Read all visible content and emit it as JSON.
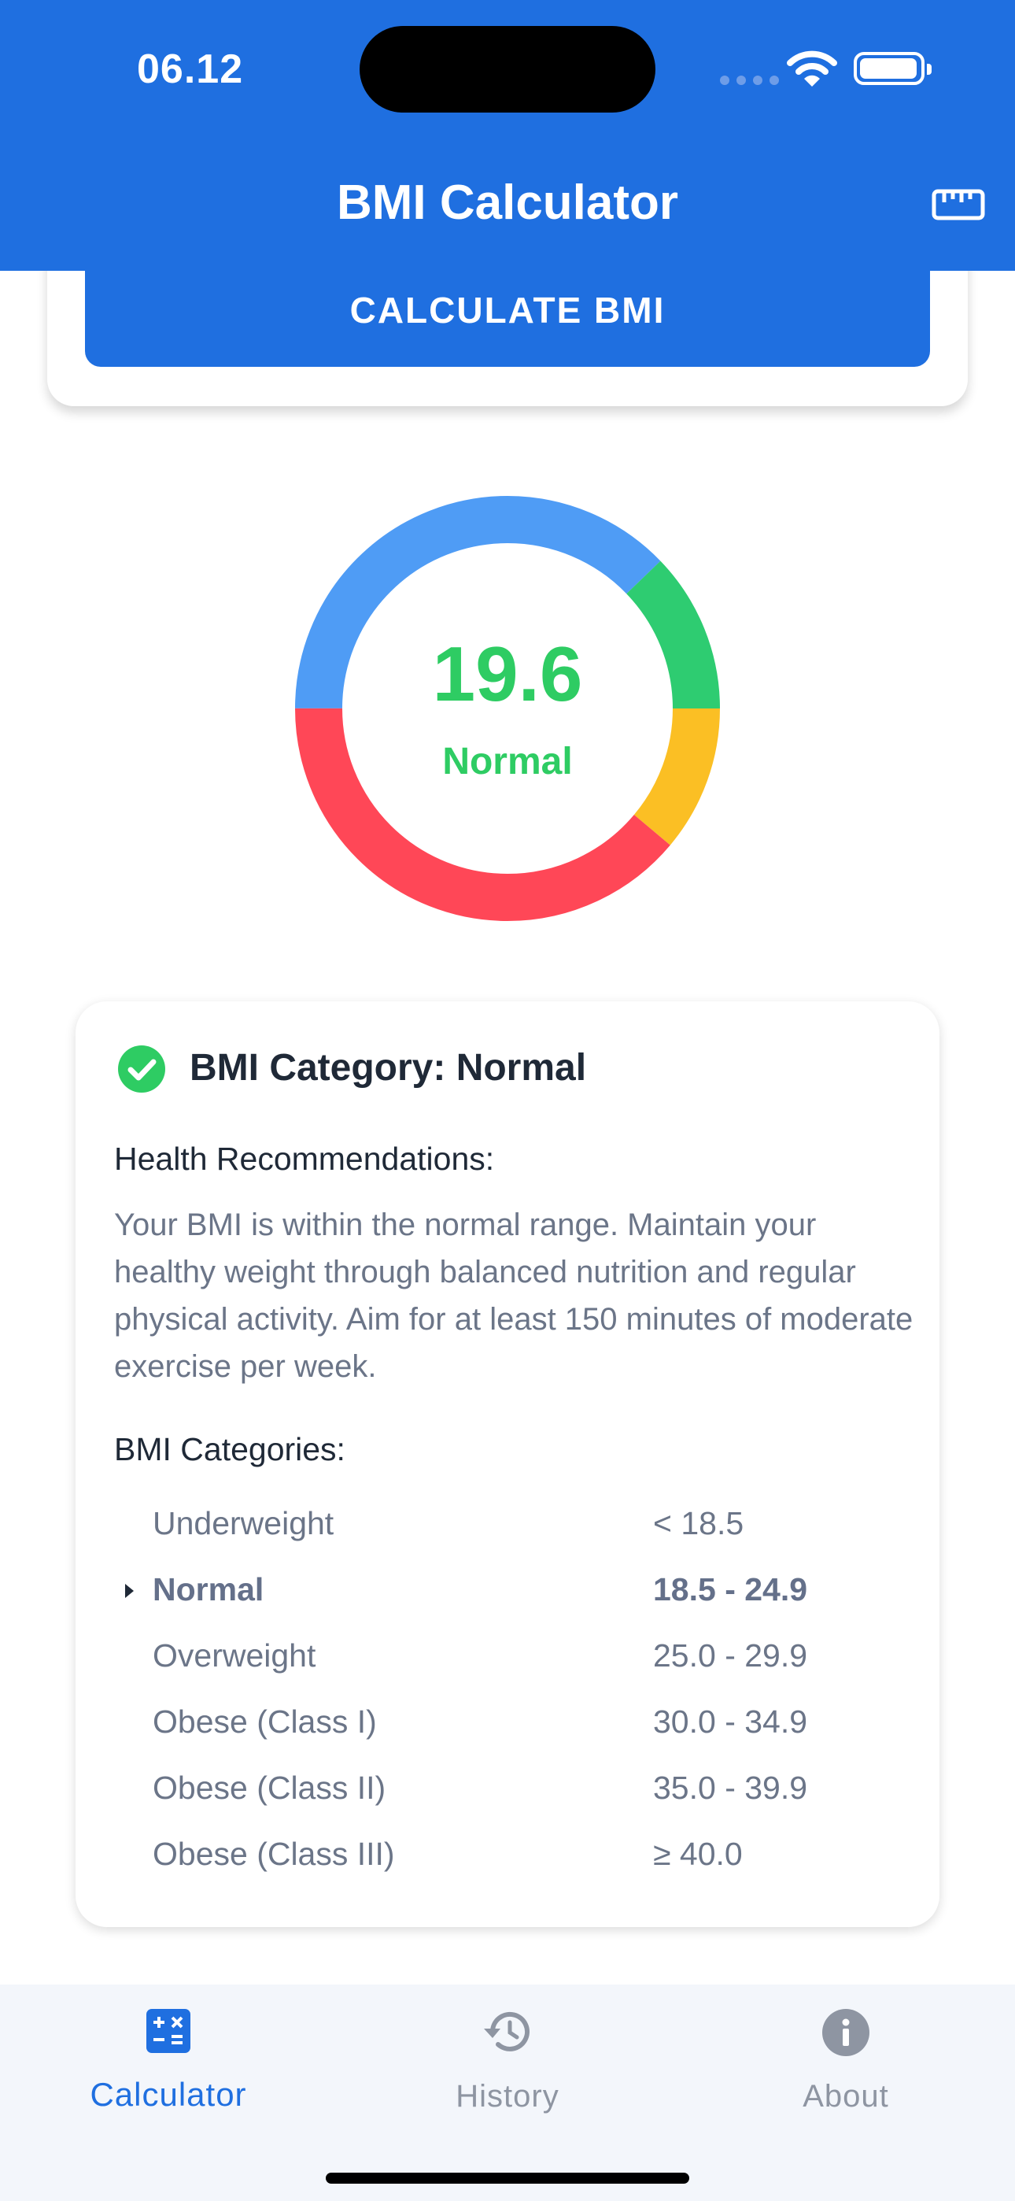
{
  "status_bar": {
    "time": "06.12"
  },
  "header": {
    "title": "BMI Calculator"
  },
  "form": {
    "calculate_label": "CALCULATE BMI"
  },
  "gauge": {
    "value": "19.6",
    "category": "Normal",
    "colors": {
      "underweight": "#4f9cf5",
      "normal": "#2ecc71",
      "overweight": "#fbbf24",
      "obese": "#ff4757"
    }
  },
  "result": {
    "title": "BMI Category: Normal",
    "recommendation_heading": "Health Recommendations:",
    "recommendation_text": "Your BMI is within the normal range. Maintain your healthy weight through balanced nutrition and regular physical activity. Aim for at least 150 minutes of moderate exercise per week.",
    "categories_heading": "BMI Categories:",
    "categories": [
      {
        "name": "Underweight",
        "range": "< 18.5"
      },
      {
        "name": "Normal",
        "range": "18.5 - 24.9"
      },
      {
        "name": "Overweight",
        "range": "25.0 - 29.9"
      },
      {
        "name": "Obese (Class I)",
        "range": "30.0 - 34.9"
      },
      {
        "name": "Obese (Class II)",
        "range": "35.0 - 39.9"
      },
      {
        "name": "Obese (Class III)",
        "range": "≥ 40.0"
      }
    ]
  },
  "tabs": [
    {
      "label": "Calculator",
      "icon": "calculator-icon"
    },
    {
      "label": "History",
      "icon": "history-icon"
    },
    {
      "label": "About",
      "icon": "info-icon"
    }
  ],
  "colors": {
    "primary": "#1f6fe0",
    "success": "#2ecc63",
    "muted_text": "#6b7588"
  }
}
